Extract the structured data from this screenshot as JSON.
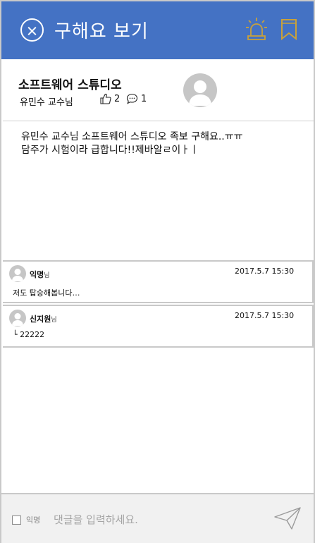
{
  "header": {
    "title": "구해요 보기",
    "close_icon": "close-circle-icon",
    "alarm_icon": "siren-icon",
    "bookmark_icon": "bookmark-icon",
    "accent_color": "#4472c4",
    "icon_color": "#c9a13a"
  },
  "post": {
    "title": "소프트웨어 스튜디오",
    "author": "유민수 교수님",
    "likes": "2",
    "comments": "1",
    "body_line1": "유민수 교수님 소프트웨어 스튜디오 족보 구해요..ㅠㅠ",
    "body_line2": "담주가 시험이라 급합니다!!제바알ㄹ이ㅏㅣ"
  },
  "comments": [
    {
      "name": "익명",
      "suffix": "님",
      "time": "2017.5.7 15:30",
      "text": "저도 탑승해봅니다…"
    },
    {
      "name": "신지원",
      "suffix": "님",
      "time": "2017.5.7 15:30",
      "reply_mark": "└",
      "text": "22222"
    }
  ],
  "footer": {
    "anonymous_label": "익명",
    "input_placeholder": "댓글을 입력하세요.",
    "send_icon": "paper-plane-icon"
  }
}
